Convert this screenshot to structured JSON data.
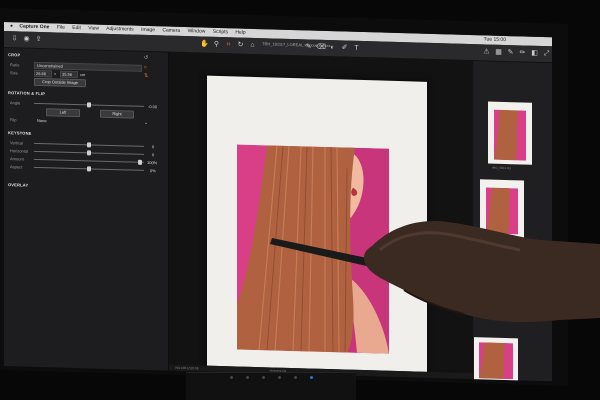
{
  "menubar": {
    "app": "Capture One",
    "items": [
      "File",
      "Edit",
      "View",
      "Adjustments",
      "Image",
      "Camera",
      "Window",
      "Scripts",
      "Help"
    ],
    "clock": "Tue 15:00"
  },
  "toolbar": {
    "filename": "TRH_191117_LOREAL.xxxxxxxxxxxxx"
  },
  "crop": {
    "title": "CROP",
    "ratio_label": "Ratio",
    "ratio_value": "Unconstrained",
    "size_label": "Size",
    "size_w": "26.66",
    "size_h": "35.56",
    "size_unit": "cm",
    "outside_button": "Crop Outside Image"
  },
  "rotation": {
    "title": "ROTATION & FLIP",
    "angle_label": "Angle",
    "angle_value": "-0.00",
    "left_button": "Left",
    "right_button": "Right",
    "flip_label": "Flip",
    "flip_value": "None"
  },
  "keystone": {
    "title": "KEYSTONE",
    "rows": [
      {
        "label": "Vertical",
        "value": "0"
      },
      {
        "label": "Horizontal",
        "value": "0"
      },
      {
        "label": "Amount",
        "value": "100%"
      },
      {
        "label": "Aspect",
        "value": "0%"
      }
    ]
  },
  "overlay": {
    "title": "OVERLAY"
  },
  "filmstrip": {
    "labels": [
      "IMG_0001.IIQ",
      "IMG_0002.IIQ"
    ]
  },
  "status": {
    "left": "ISO 100  1/125  f/8",
    "center": "xxxxxxxx.IIQ"
  },
  "colors": {
    "accent": "#e06a2a",
    "magenta": "#d83f86",
    "hair": "#b06240"
  }
}
